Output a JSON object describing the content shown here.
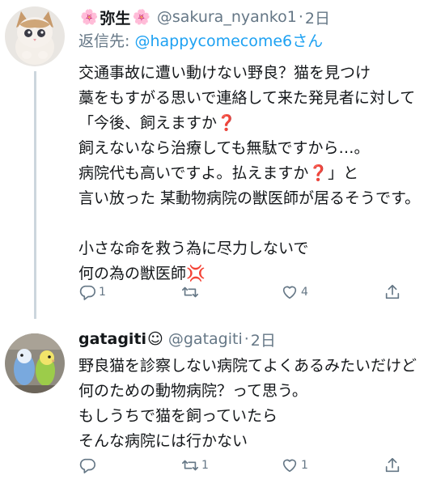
{
  "tweets": [
    {
      "display_name": "弥生",
      "name_prefix_emoji": "🌸",
      "name_suffix_emoji": "🌸",
      "handle": "@sakura_nyanko1",
      "separator": "·",
      "time": "2日",
      "reply_label": "返信先: ",
      "reply_mention": "@happycomecome6",
      "reply_suffix": "さん",
      "lines": [
        "交通事故に遭い動けない野良？猫を見つけ",
        "藁をもすがる思いで連絡して来た発見者に対して",
        "「今後、飼えますか",
        "飼えないなら治療しても無駄ですから…。",
        "病院代も高いですよ。払えますか",
        "言い放った 某動物病院の獣医師が居るそうです。",
        "",
        "小さな命を救う為に尽力しないで",
        "何の為の獣医師"
      ],
      "line3_emoji": "❓",
      "line5_emoji": "❓",
      "line5_tail": "」と",
      "line9_emoji": "💢",
      "actions": {
        "reply_count": "1",
        "retweet_count": "",
        "like_count": "4"
      },
      "avatar_icon": "kitten-avatar"
    },
    {
      "display_name": "gatagiti",
      "name_suffix_emoji": "☺",
      "handle": "@gatagiti",
      "separator": "·",
      "time": "2日",
      "lines": [
        "野良猫を診察しない病院てよくあるみたいだけど",
        "何のための動物病院？って思う。",
        "もしうちで猫を飼っていたら",
        "そんな病院には行かない"
      ],
      "actions": {
        "reply_count": "",
        "retweet_count": "1",
        "like_count": "1"
      },
      "avatar_icon": "parakeet-avatar"
    }
  ],
  "colors": {
    "text": "#14171a",
    "secondary": "#657786",
    "link": "#1da1f2",
    "thread_line": "#ccd6dd",
    "accent_red": "#e0245e"
  },
  "icons": [
    "reply-icon",
    "retweet-icon",
    "like-icon",
    "share-icon"
  ]
}
